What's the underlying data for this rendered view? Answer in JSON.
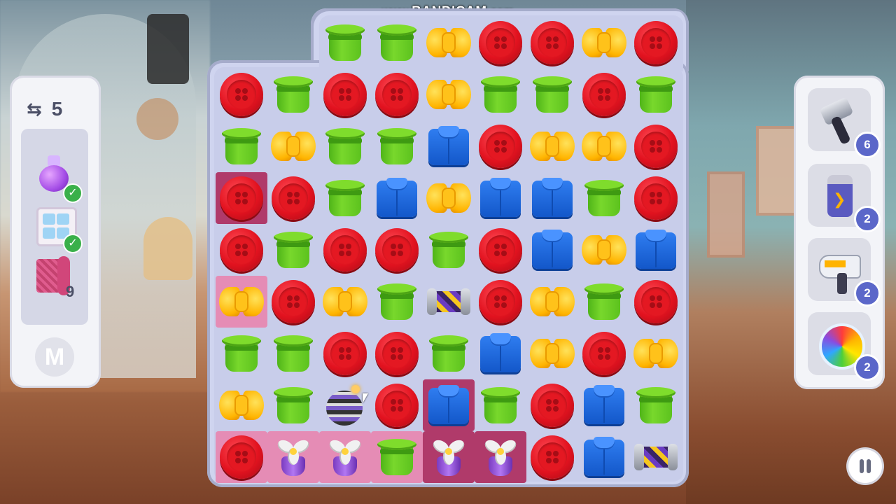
{
  "watermark": {
    "prefix": "www.",
    "brand": "BANDICAM",
    "suffix": ".com"
  },
  "moves": {
    "count": "5",
    "icon": "swap-arrows-icon"
  },
  "goals": [
    {
      "name": "potion",
      "icon": "potion-icon",
      "status": "complete"
    },
    {
      "name": "cabinet",
      "icon": "cabinet-icon",
      "status": "complete"
    },
    {
      "name": "mat",
      "icon": "pink-mat-icon",
      "remaining": "9"
    }
  ],
  "menu_label": "M",
  "boosters": [
    {
      "name": "hammer",
      "icon": "hammer-icon",
      "count": "6"
    },
    {
      "name": "glove",
      "icon": "glove-icon",
      "count": "2"
    },
    {
      "name": "hair-dryer",
      "icon": "hair-dryer-icon",
      "count": "2"
    },
    {
      "name": "shuffle",
      "icon": "rainbow-shuffle-icon",
      "count": "2"
    }
  ],
  "board": {
    "rows": [
      [
        "empty",
        "empty",
        "bucket",
        "bucket",
        "bow",
        "button",
        "button",
        "bow",
        "button"
      ],
      [
        "button",
        "bucket",
        "button",
        "button",
        "bow",
        "bucket",
        "bucket",
        "button",
        "bucket"
      ],
      [
        "bucket",
        "bow",
        "bucket",
        "bucket",
        "shirt",
        "button",
        "bow",
        "bow",
        "button"
      ],
      [
        "button",
        "button",
        "bucket",
        "shirt",
        "bow",
        "shirt",
        "shirt",
        "bucket",
        "button"
      ],
      [
        "button",
        "bucket",
        "button",
        "button",
        "bucket",
        "button",
        "shirt",
        "bow",
        "shirt"
      ],
      [
        "bow",
        "button",
        "bow",
        "bucket",
        "roller",
        "button",
        "bow",
        "bucket",
        "button"
      ],
      [
        "bucket",
        "bucket",
        "button",
        "button",
        "bucket",
        "shirt",
        "bow",
        "button",
        "bow"
      ],
      [
        "bow",
        "bucket",
        "bomb",
        "button",
        "shirt",
        "bucket",
        "button",
        "shirt",
        "bucket"
      ],
      [
        "button",
        "fan",
        "fan",
        "bucket",
        "fan",
        "fan",
        "button",
        "shirt",
        "roller"
      ]
    ]
  }
}
